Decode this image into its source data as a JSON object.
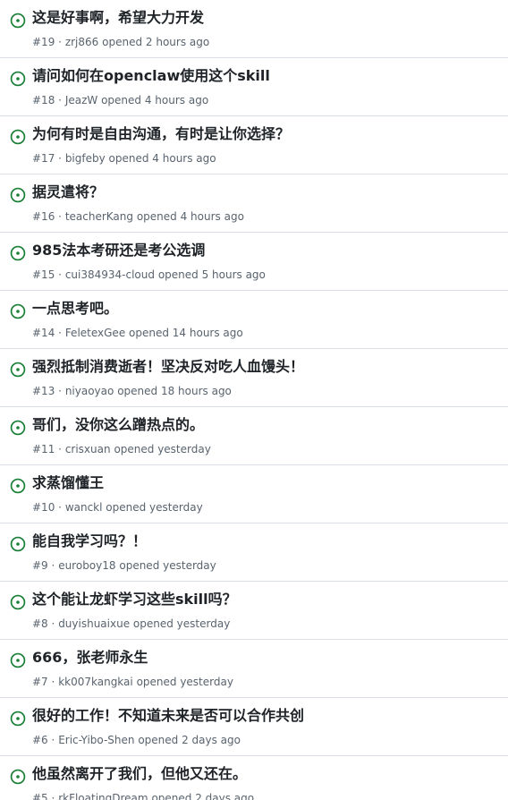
{
  "colors": {
    "open_icon": "#1a7f37",
    "title": "#1f2328",
    "meta": "#59636e",
    "divider": "#d8dee4"
  },
  "issues": [
    {
      "title": "这是好事啊，希望大力开发",
      "number": "#19",
      "author": "zrj866",
      "opened": "opened 2 hours ago"
    },
    {
      "title": "请问如何在openclaw使用这个skill",
      "number": "#18",
      "author": "JeazW",
      "opened": "opened 4 hours ago"
    },
    {
      "title": "为何有时是自由沟通，有时是让你选择？",
      "number": "#17",
      "author": "bigfeby",
      "opened": "opened 4 hours ago"
    },
    {
      "title": "据灵遣将？",
      "number": "#16",
      "author": "teacherKang",
      "opened": "opened 4 hours ago"
    },
    {
      "title": "985法本考研还是考公选调",
      "number": "#15",
      "author": "cui384934-cloud",
      "opened": "opened 5 hours ago"
    },
    {
      "title": "一点思考吧。",
      "number": "#14",
      "author": "FeletexGee",
      "opened": "opened 14 hours ago"
    },
    {
      "title": "强烈抵制消费逝者！坚决反对吃人血馒头！",
      "number": "#13",
      "author": "niyaoyao",
      "opened": "opened 18 hours ago"
    },
    {
      "title": "哥们，没你这么蹭热点的。",
      "number": "#11",
      "author": "crisxuan",
      "opened": "opened yesterday"
    },
    {
      "title": "求蒸馏懂王",
      "number": "#10",
      "author": "wanckl",
      "opened": "opened yesterday"
    },
    {
      "title": "能自我学习吗？！",
      "number": "#9",
      "author": "euroboy18",
      "opened": "opened yesterday"
    },
    {
      "title": "这个能让龙虾学习这些skill吗？",
      "number": "#8",
      "author": "duyishuaixue",
      "opened": "opened yesterday"
    },
    {
      "title": "666，张老师永生",
      "number": "#7",
      "author": "kk007kangkai",
      "opened": "opened yesterday"
    },
    {
      "title": "很好的工作！不知道未来是否可以合作共创",
      "number": "#6",
      "author": "Eric-Yibo-Shen",
      "opened": "opened 2 days ago"
    },
    {
      "title": "他虽然离开了我们，但他又还在。",
      "number": "#5",
      "author": "rkFloatingDream",
      "opened": "opened 2 days ago"
    }
  ],
  "separator": "·",
  "icon": "issue-opened-icon"
}
